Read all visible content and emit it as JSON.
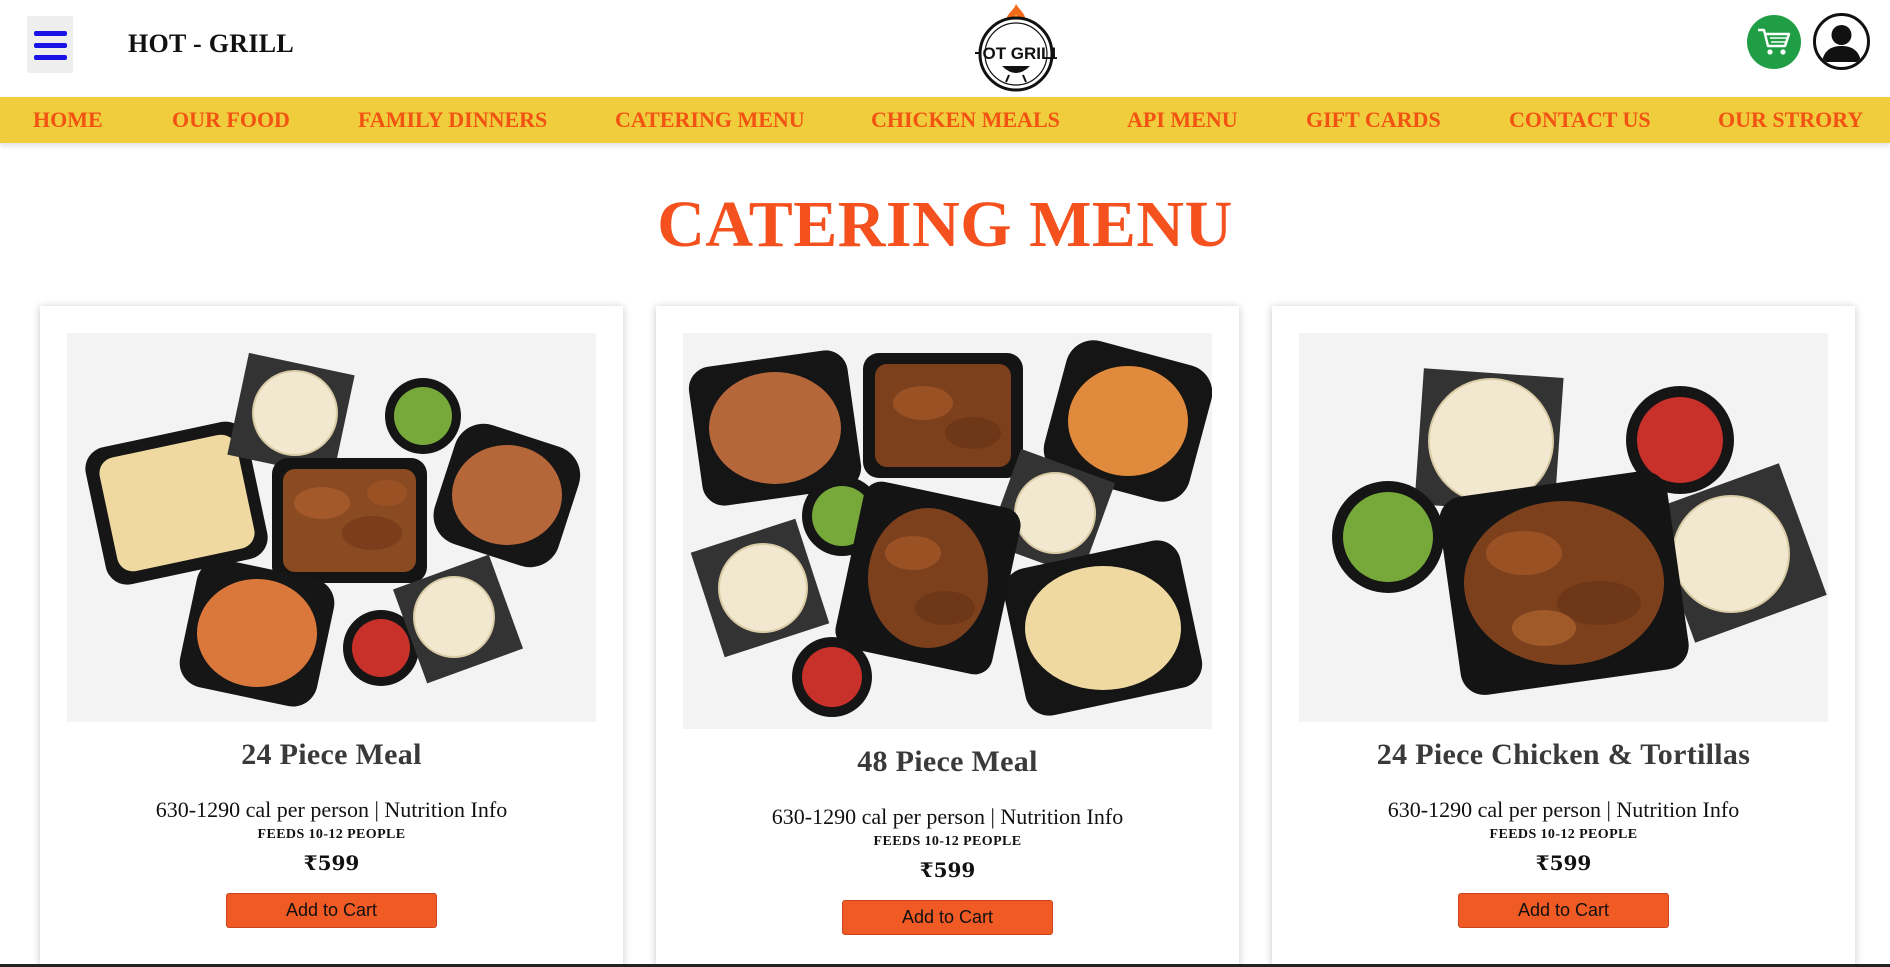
{
  "header": {
    "brand_name": "HOT - GRILL",
    "logo_text": "HOT GRILL",
    "menu_icon": "hamburger-menu-icon",
    "cart_icon": "shopping-cart-icon",
    "account_icon": "user-account-icon"
  },
  "nav": {
    "items": [
      {
        "label": "HOME"
      },
      {
        "label": "OUR FOOD"
      },
      {
        "label": "FAMILY DINNERS"
      },
      {
        "label": "CATERING MENU"
      },
      {
        "label": "CHICKEN MEALS"
      },
      {
        "label": "API MENU"
      },
      {
        "label": "GIFT CARDS"
      },
      {
        "label": "CONTACT US"
      },
      {
        "label": "OUR STRORY"
      }
    ]
  },
  "page": {
    "title": "CATERING MENU"
  },
  "cards": [
    {
      "title": "24 Piece Meal",
      "calories": "630-1290 cal per person | Nutrition Info",
      "feeds": "FEEDS 10-12 PEOPLE",
      "price": "₹599",
      "button": "Add to Cart"
    },
    {
      "title": "48 Piece Meal",
      "calories": "630-1290 cal per person | Nutrition Info",
      "feeds": "FEEDS 10-12 PEOPLE",
      "price": "₹599",
      "button": "Add to Cart"
    },
    {
      "title": "24 Piece Chicken & Tortillas",
      "calories": "630-1290 cal per person | Nutrition Info",
      "feeds": "FEEDS 10-12 PEOPLE",
      "price": "₹599",
      "button": "Add to Cart"
    }
  ],
  "colors": {
    "nav_background": "#f0cd3c",
    "accent_orange": "#f4511e",
    "button_orange": "#f05a24",
    "cart_green": "#1f9e45",
    "menu_blue": "#1a13e8"
  }
}
